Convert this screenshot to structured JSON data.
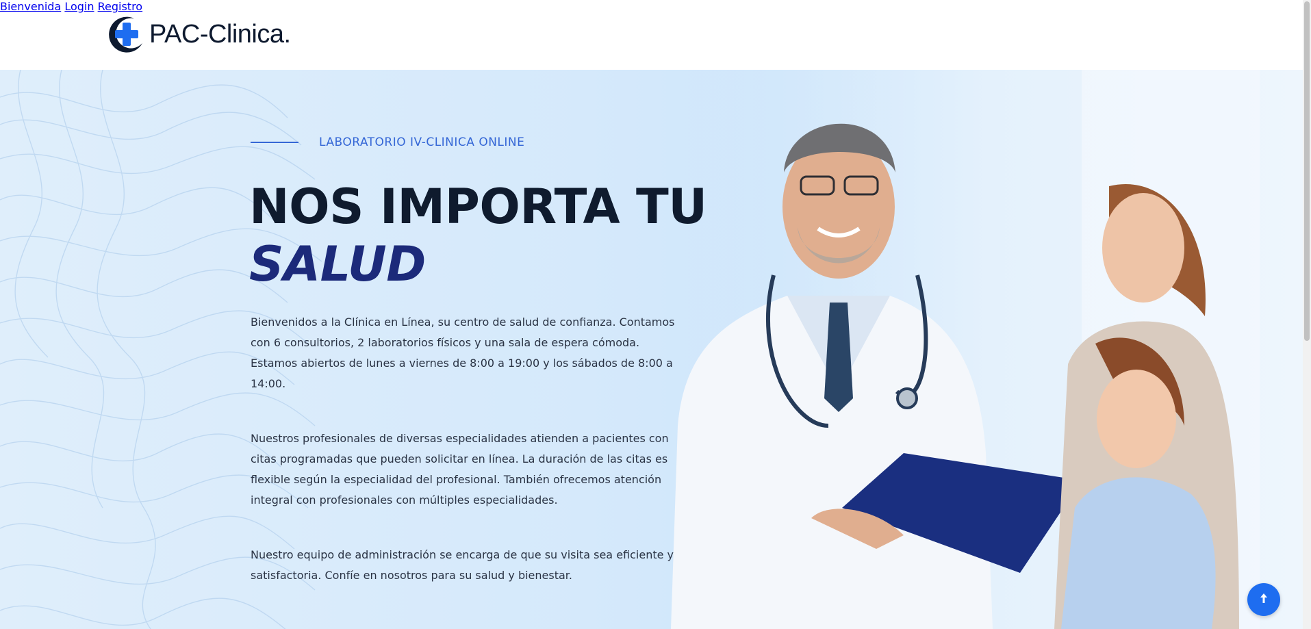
{
  "header": {
    "logo_text": "PAC-Clinica.",
    "nav": [
      {
        "label": "Bienvenida"
      },
      {
        "label": "Login"
      },
      {
        "label": "Registro"
      }
    ]
  },
  "hero": {
    "eyebrow": "LABORATORIO IV-CLINICA ONLINE",
    "headline_line1": "NOS IMPORTA TU",
    "headline_line2": "SALUD",
    "paragraphs": [
      "Bienvenidos a la Clínica en Línea, su centro de salud de confianza. Contamos con 6 consultorios, 2 laboratorios físicos y una sala de espera cómoda. Estamos abiertos de lunes a viernes de 8:00 a 19:00 y los sábados de 8:00 a 14:00.",
      "Nuestros profesionales de diversas especialidades atienden a pacientes con citas programadas que pueden solicitar en línea. La duración de las citas es flexible según la especialidad del profesional. También ofrecemos atención integral con profesionales con múltiples especialidades.",
      "Nuestro equipo de administración se encarga de que su visita sea eficiente y satisfactoria. Confíe en nosotros para su salud y bienestar."
    ]
  },
  "icons": {
    "logo": "medical-cross-icon",
    "scroll_top": "arrow-up-icon"
  },
  "colors": {
    "accent": "#3567d6",
    "headline": "#0f1b2e",
    "headline_accent": "#1c2a7a",
    "scroll_button": "#1e6df0"
  }
}
